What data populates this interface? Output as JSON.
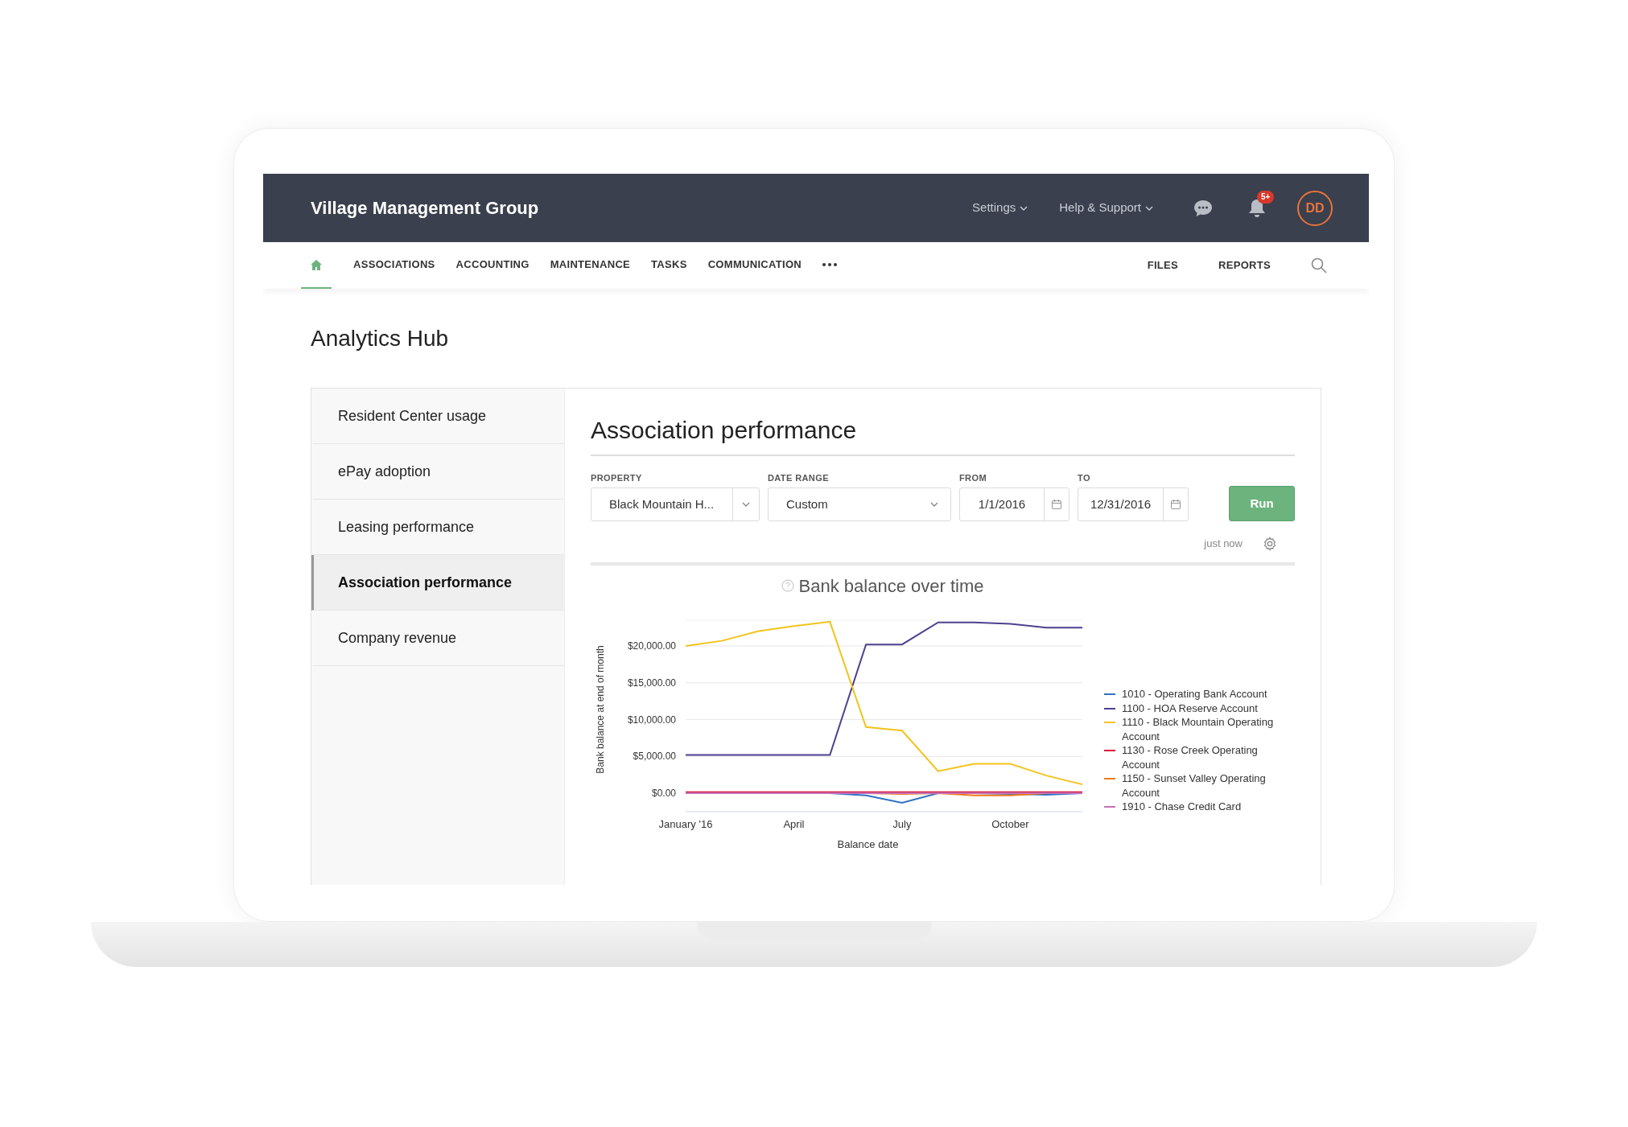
{
  "header": {
    "title": "Village Management Group",
    "menus": [
      {
        "label": "Settings"
      },
      {
        "label": "Help & Support"
      }
    ],
    "notifications_badge": "5+",
    "avatar": "DD"
  },
  "nav": {
    "items": [
      {
        "kind": "home",
        "selected": true
      },
      {
        "kind": "link",
        "label": "ASSOCIATIONS",
        "selected": false
      },
      {
        "kind": "link",
        "label": "ACCOUNTING",
        "selected": false
      },
      {
        "kind": "link",
        "label": "MAINTENANCE",
        "selected": false
      },
      {
        "kind": "link",
        "label": "TASKS",
        "selected": false
      },
      {
        "kind": "link",
        "label": "COMMUNICATION",
        "selected": false
      },
      {
        "kind": "more",
        "selected": false
      }
    ],
    "right_items": [
      "FILES",
      "REPORTS"
    ]
  },
  "page_title": "Analytics Hub",
  "sidebar": {
    "items": [
      {
        "label": "Resident Center usage",
        "selected": false
      },
      {
        "label": "ePay adoption",
        "selected": false
      },
      {
        "label": "Leasing performance",
        "selected": false
      },
      {
        "label": "Association performance",
        "selected": true
      },
      {
        "label": "Company revenue",
        "selected": false
      }
    ]
  },
  "report": {
    "title": "Association performance",
    "filters": [
      {
        "kind": "select",
        "label": "PROPERTY",
        "value": "Black Mountain H..."
      },
      {
        "kind": "select",
        "label": "DATE RANGE",
        "value": "Custom"
      },
      {
        "kind": "date",
        "label": "FROM",
        "value": "1/1/2016"
      },
      {
        "kind": "date",
        "label": "TO",
        "value": "12/31/2016"
      }
    ],
    "run_button": "Run",
    "updated": "just now",
    "chart": {
      "title": "Bank balance over time",
      "chart_data": {
        "type": "line",
        "xlabel": "Balance date",
        "ylabel": "Bank balance at end of month",
        "categories": [
          "January '16",
          null,
          null,
          "April",
          null,
          null,
          "July",
          null,
          null,
          "October",
          null,
          null
        ],
        "grid": true,
        "ylim": [
          -2500,
          23500
        ],
        "yticks": [
          {
            "value": 0,
            "label": "$0.00"
          },
          {
            "value": 5000,
            "label": "$5,000.00"
          },
          {
            "value": 10000,
            "label": "$10,000.00"
          },
          {
            "value": 15000,
            "label": "$15,000.00"
          },
          {
            "value": 20000,
            "label": "$20,000.00"
          }
        ],
        "series": [
          {
            "name": "1010 - Operating Bank Account",
            "color": "#2f72c4",
            "values": [
              null,
              null,
              null,
              0,
              0,
              -300,
              -1300,
              0,
              0,
              -100,
              -200,
              0
            ]
          },
          {
            "name": "1100 - HOA Reserve Account",
            "color": "#4e3f8f",
            "values": [
              5200,
              5200,
              5200,
              5200,
              5200,
              20200,
              20200,
              23200,
              23200,
              23000,
              22500,
              22500
            ]
          },
          {
            "name": "1110 - Black Mountain Operating Account",
            "color": "#f3c31c",
            "values": [
              20000,
              20700,
              22000,
              22700,
              23300,
              9000,
              8500,
              3000,
              4000,
              4000,
              2400,
              1200
            ]
          },
          {
            "name": "1130 - Rose Creek Operating Account",
            "color": "#d9143a",
            "values": [
              150,
              150,
              150,
              150,
              150,
              150,
              150,
              150,
              150,
              150,
              150,
              150
            ]
          },
          {
            "name": "1150 - Sunset Valley Operating Account",
            "color": "#f07a18",
            "values": [
              null,
              null,
              null,
              null,
              0,
              0,
              -100,
              0,
              -300,
              -300,
              0,
              0
            ]
          },
          {
            "name": "1910 - Chase Credit Card",
            "color": "#c86fb4",
            "values": [
              0,
              0,
              0,
              0,
              0,
              0,
              0,
              0,
              0,
              0,
              0,
              0
            ]
          }
        ]
      }
    }
  }
}
